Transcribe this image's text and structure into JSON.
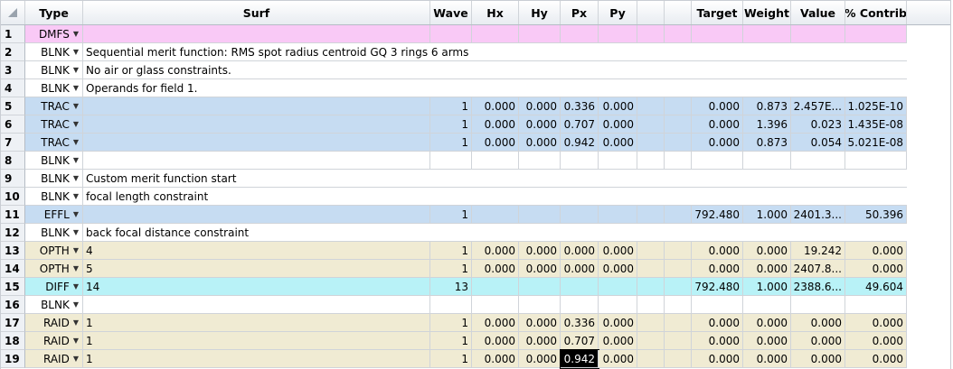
{
  "headers": [
    "Type",
    "Surf",
    "Wave",
    "Hx",
    "Hy",
    "Px",
    "Py",
    "",
    "",
    "Target",
    "Weight",
    "Value",
    "% Contrib"
  ],
  "rows": [
    {
      "num": "1",
      "type": "DMFS",
      "color": "pink",
      "comment": "",
      "cells": [
        "",
        "",
        "",
        "",
        "",
        "",
        "",
        "",
        "",
        "",
        "",
        ""
      ]
    },
    {
      "num": "2",
      "type": "BLNK",
      "color": "white",
      "comment": "Sequential merit function: RMS spot radius centroid GQ 3 rings 6 arms",
      "cells": []
    },
    {
      "num": "3",
      "type": "BLNK",
      "color": "white",
      "comment": "No air or glass constraints.",
      "cells": []
    },
    {
      "num": "4",
      "type": "BLNK",
      "color": "white",
      "comment": "Operands for field 1.",
      "cells": []
    },
    {
      "num": "5",
      "type": "TRAC",
      "color": "blue",
      "comment": "",
      "cells": [
        "",
        "1",
        "0.000",
        "0.000",
        "0.336",
        "0.000",
        "",
        "",
        "0.000",
        "0.873",
        "2.457E...",
        "1.025E-10"
      ]
    },
    {
      "num": "6",
      "type": "TRAC",
      "color": "blue",
      "comment": "",
      "cells": [
        "",
        "1",
        "0.000",
        "0.000",
        "0.707",
        "0.000",
        "",
        "",
        "0.000",
        "1.396",
        "0.023",
        "1.435E-08"
      ]
    },
    {
      "num": "7",
      "type": "TRAC",
      "color": "blue",
      "comment": "",
      "cells": [
        "",
        "1",
        "0.000",
        "0.000",
        "0.942",
        "0.000",
        "",
        "",
        "0.000",
        "0.873",
        "0.054",
        "5.021E-08"
      ]
    },
    {
      "num": "8",
      "type": "BLNK",
      "color": "white",
      "comment": "",
      "cells": []
    },
    {
      "num": "9",
      "type": "BLNK",
      "color": "white",
      "comment": "Custom merit function start",
      "cells": []
    },
    {
      "num": "10",
      "type": "BLNK",
      "color": "white",
      "comment": "focal length constraint",
      "cells": []
    },
    {
      "num": "11",
      "type": "EFFL",
      "color": "blue",
      "comment": "",
      "cells": [
        "",
        "1",
        "",
        "",
        "",
        "",
        "",
        "",
        "792.480",
        "1.000",
        "2401.3...",
        "50.396"
      ]
    },
    {
      "num": "12",
      "type": "BLNK",
      "color": "white",
      "comment": "back focal distance constraint",
      "cells": []
    },
    {
      "num": "13",
      "type": "OPTH",
      "color": "tan",
      "comment": "",
      "cells": [
        "4",
        "1",
        "0.000",
        "0.000",
        "0.000",
        "0.000",
        "",
        "",
        "0.000",
        "0.000",
        "19.242",
        "0.000"
      ]
    },
    {
      "num": "14",
      "type": "OPTH",
      "color": "tan",
      "comment": "",
      "cells": [
        "5",
        "1",
        "0.000",
        "0.000",
        "0.000",
        "0.000",
        "",
        "",
        "0.000",
        "0.000",
        "2407.8...",
        "0.000"
      ]
    },
    {
      "num": "15",
      "type": "DIFF",
      "color": "cyan",
      "comment": "",
      "cells": [
        "14",
        "13",
        "",
        "",
        "",
        "",
        "",
        "",
        "792.480",
        "1.000",
        "2388.6...",
        "49.604"
      ]
    },
    {
      "num": "16",
      "type": "BLNK",
      "color": "white",
      "comment": "",
      "cells": []
    },
    {
      "num": "17",
      "type": "RAID",
      "color": "tan",
      "comment": "",
      "cells": [
        "1",
        "1",
        "0.000",
        "0.000",
        "0.336",
        "0.000",
        "",
        "",
        "0.000",
        "0.000",
        "0.000",
        "0.000"
      ]
    },
    {
      "num": "18",
      "type": "RAID",
      "color": "tan",
      "comment": "",
      "cells": [
        "1",
        "1",
        "0.000",
        "0.000",
        "0.707",
        "0.000",
        "",
        "",
        "0.000",
        "0.000",
        "0.000",
        "0.000"
      ]
    },
    {
      "num": "19",
      "type": "RAID",
      "color": "tan",
      "comment": "",
      "cells": [
        "1",
        "1",
        "0.000",
        "0.000",
        "0.942",
        "0.000",
        "",
        "",
        "0.000",
        "0.000",
        "0.000",
        "0.000"
      ]
    }
  ],
  "selected_cell": {
    "row": "19",
    "column": "Px"
  }
}
